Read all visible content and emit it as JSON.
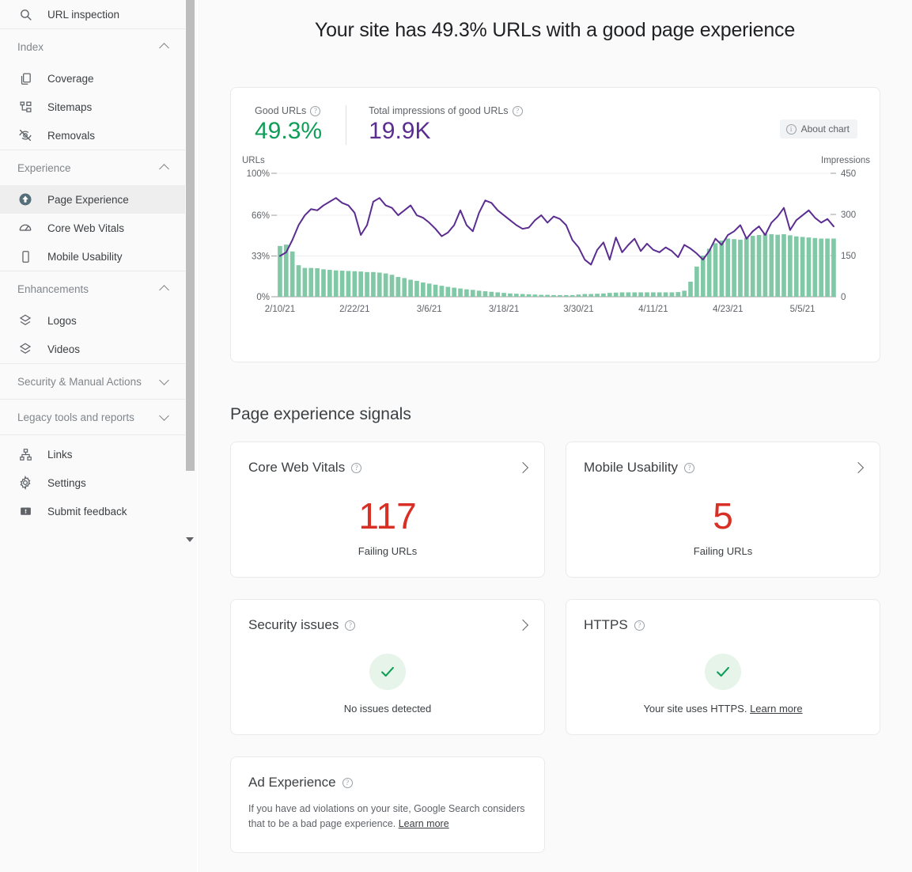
{
  "sidebar": {
    "top_item": {
      "label": "URL inspection",
      "icon": "search-icon"
    },
    "groups": [
      {
        "title": "Index",
        "collapsed": false,
        "items": [
          {
            "label": "Coverage",
            "icon": "coverage-icon"
          },
          {
            "label": "Sitemaps",
            "icon": "sitemaps-icon"
          },
          {
            "label": "Removals",
            "icon": "removals-icon"
          }
        ]
      },
      {
        "title": "Experience",
        "collapsed": false,
        "items": [
          {
            "label": "Page Experience",
            "icon": "page-experience-icon",
            "active": true
          },
          {
            "label": "Core Web Vitals",
            "icon": "gauge-icon"
          },
          {
            "label": "Mobile Usability",
            "icon": "mobile-icon"
          }
        ]
      },
      {
        "title": "Enhancements",
        "collapsed": false,
        "items": [
          {
            "label": "Logos",
            "icon": "layers-icon"
          },
          {
            "label": "Videos",
            "icon": "layers-icon"
          }
        ]
      },
      {
        "title": "Security & Manual Actions",
        "collapsed": true,
        "items": []
      },
      {
        "title": "Legacy tools and reports",
        "collapsed": true,
        "items": []
      }
    ],
    "footer_items": [
      {
        "label": "Links",
        "icon": "links-icon"
      },
      {
        "label": "Settings",
        "icon": "gear-icon"
      },
      {
        "label": "Submit feedback",
        "icon": "feedback-icon"
      }
    ]
  },
  "header": {
    "title": "Your site has 49.3% URLs with a good page experience"
  },
  "chart_card": {
    "kpis": [
      {
        "label": "Good URLs",
        "value": "49.3%",
        "color": "#0f9d58",
        "help": "?"
      },
      {
        "label": "Total impressions of good URLs",
        "value": "19.9K",
        "color": "#5c2d91",
        "help": "?"
      }
    ],
    "about_chart_label": "About chart",
    "about_chart_icon": "info-icon"
  },
  "chart_data": {
    "type": "line",
    "title": "",
    "xlabel": "",
    "ylabel": "URLs",
    "y2label": "Impressions",
    "ylim": [
      0,
      100
    ],
    "y2lim": [
      0,
      450
    ],
    "yticks": [
      "0%",
      "33%",
      "66%",
      "100%"
    ],
    "ytick_values": [
      0,
      33,
      66,
      100
    ],
    "y2ticks": [
      "0",
      "150",
      "300",
      "450"
    ],
    "y2tick_values": [
      0,
      150,
      300,
      450
    ],
    "grid": true,
    "legend_position": "none",
    "xticks": [
      "2/10/21",
      "2/22/21",
      "3/6/21",
      "3/18/21",
      "3/30/21",
      "4/11/21",
      "4/23/21",
      "5/5/21"
    ],
    "xtick_indices": [
      0,
      12,
      24,
      36,
      48,
      60,
      72,
      84
    ],
    "x": [
      "2/10/21",
      "2/11/21",
      "2/12/21",
      "2/13/21",
      "2/14/21",
      "2/15/21",
      "2/16/21",
      "2/17/21",
      "2/18/21",
      "2/19/21",
      "2/20/21",
      "2/21/21",
      "2/22/21",
      "2/23/21",
      "2/24/21",
      "2/25/21",
      "2/26/21",
      "2/27/21",
      "2/28/21",
      "3/1/21",
      "3/2/21",
      "3/3/21",
      "3/4/21",
      "3/5/21",
      "3/6/21",
      "3/7/21",
      "3/8/21",
      "3/9/21",
      "3/10/21",
      "3/11/21",
      "3/12/21",
      "3/13/21",
      "3/14/21",
      "3/15/21",
      "3/16/21",
      "3/17/21",
      "3/18/21",
      "3/19/21",
      "3/20/21",
      "3/21/21",
      "3/22/21",
      "3/23/21",
      "3/24/21",
      "3/25/21",
      "3/26/21",
      "3/27/21",
      "3/28/21",
      "3/29/21",
      "3/30/21",
      "3/31/21",
      "4/1/21",
      "4/2/21",
      "4/3/21",
      "4/4/21",
      "4/5/21",
      "4/6/21",
      "4/7/21",
      "4/8/21",
      "4/9/21",
      "4/10/21",
      "4/11/21",
      "4/12/21",
      "4/13/21",
      "4/14/21",
      "4/15/21",
      "4/16/21",
      "4/17/21",
      "4/18/21",
      "4/19/21",
      "4/20/21",
      "4/21/21",
      "4/22/21",
      "4/23/21",
      "4/24/21",
      "4/25/21",
      "4/26/21",
      "4/27/21",
      "4/28/21",
      "4/29/21",
      "4/30/21",
      "5/1/21",
      "5/2/21",
      "5/3/21",
      "5/4/21",
      "5/5/21",
      "5/6/21",
      "5/7/21",
      "5/8/21",
      "5/9/21"
    ],
    "series": [
      {
        "name": "URLs",
        "axis": "left",
        "style": "line",
        "color": "#5c2d91",
        "unit": "%",
        "values": [
          33,
          36,
          46,
          58,
          66,
          71,
          70,
          74,
          77,
          80,
          76,
          74,
          68,
          50,
          58,
          77,
          80,
          74,
          72,
          66,
          70,
          74,
          66,
          64,
          60,
          55,
          49,
          52,
          58,
          70,
          58,
          53,
          68,
          78,
          76,
          70,
          66,
          62,
          58,
          55,
          56,
          62,
          66,
          60,
          65,
          63,
          58,
          46,
          40,
          30,
          26,
          38,
          44,
          30,
          48,
          36,
          42,
          47,
          37,
          43,
          38,
          36,
          40,
          37,
          32,
          42,
          39,
          35,
          30,
          37,
          47,
          42,
          50,
          53,
          58,
          47,
          53,
          57,
          50,
          60,
          65,
          72,
          54,
          62,
          66,
          70,
          64,
          60,
          63,
          57
        ]
      },
      {
        "name": "Impressions",
        "axis": "right",
        "style": "bar",
        "color": "#81c9a6",
        "unit": "",
        "values": [
          185,
          190,
          165,
          115,
          105,
          105,
          104,
          100,
          98,
          96,
          95,
          94,
          93,
          92,
          90,
          90,
          88,
          85,
          80,
          72,
          68,
          62,
          58,
          52,
          48,
          44,
          40,
          36,
          33,
          30,
          27,
          25,
          22,
          20,
          18,
          16,
          14,
          12,
          11,
          10,
          9,
          8,
          7,
          7,
          6,
          6,
          6,
          6,
          8,
          10,
          10,
          11,
          12,
          14,
          15,
          16,
          16,
          16,
          16,
          16,
          16,
          16,
          16,
          16,
          17,
          22,
          55,
          110,
          150,
          175,
          195,
          205,
          212,
          210,
          208,
          215,
          222,
          225,
          230,
          228,
          226,
          228,
          224,
          220,
          218,
          216,
          214,
          212,
          212,
          212
        ]
      }
    ]
  },
  "signals": {
    "section_title": "Page experience signals",
    "cards": [
      {
        "title": "Core Web Vitals",
        "help": "?",
        "has_arrow": true,
        "kind": "count",
        "value": "117",
        "value_color": "#d93025",
        "sub": "Failing URLs"
      },
      {
        "title": "Mobile Usability",
        "help": "?",
        "has_arrow": true,
        "kind": "count",
        "value": "5",
        "value_color": "#d93025",
        "sub": "Failing URLs"
      },
      {
        "title": "Security issues",
        "help": "?",
        "has_arrow": true,
        "kind": "ok",
        "note": "No issues detected",
        "note_link": ""
      },
      {
        "title": "HTTPS",
        "help": "?",
        "has_arrow": false,
        "kind": "ok",
        "note": "Your site uses HTTPS. ",
        "note_link": "Learn more"
      },
      {
        "title": "Ad Experience",
        "help": "?",
        "has_arrow": false,
        "kind": "text",
        "body": "If you have ad violations on your site, Google Search considers that to be a bad page experience. ",
        "body_link": "Learn more"
      }
    ]
  },
  "colors": {
    "accent_green": "#0f9d58",
    "accent_purple": "#5c2d91",
    "bar_green": "#81c9a6",
    "error_red": "#d93025",
    "ok_bg": "#e6f4ea",
    "page_bg": "#fafafa",
    "card_bg": "#ffffff"
  }
}
